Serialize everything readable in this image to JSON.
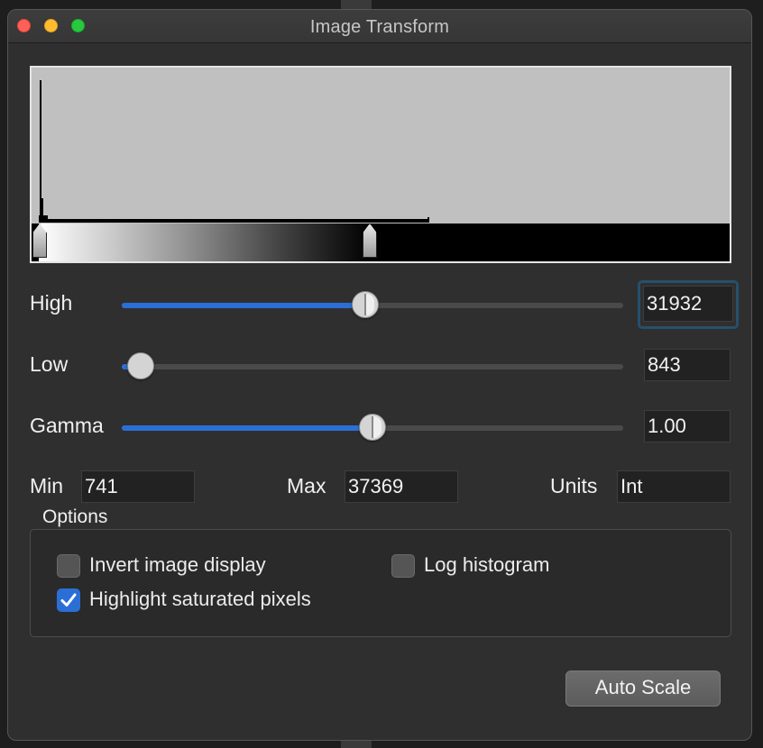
{
  "window": {
    "title": "Image Transform"
  },
  "histogram": {
    "low_handle_fraction": 0.0,
    "high_handle_fraction": 0.476
  },
  "high": {
    "label": "High",
    "value": "31932",
    "slider_fraction": 0.488
  },
  "low": {
    "label": "Low",
    "value": "843",
    "slider_fraction": 0.037
  },
  "gamma": {
    "label": "Gamma",
    "value": "1.00",
    "slider_fraction": 0.5
  },
  "stats": {
    "min_label": "Min",
    "min_value": "741",
    "max_label": "Max",
    "max_value": "37369",
    "units_label": "Units",
    "units_value": "Int"
  },
  "options": {
    "title": "Options",
    "invert": {
      "label": "Invert image display",
      "checked": false
    },
    "log": {
      "label": "Log histogram",
      "checked": false
    },
    "highlight": {
      "label": "Highlight saturated pixels",
      "checked": true
    }
  },
  "buttons": {
    "auto_scale": "Auto Scale"
  },
  "colors": {
    "accent": "#2b6fd6",
    "focus": "#26506e",
    "window_bg": "#2f2f2f"
  }
}
